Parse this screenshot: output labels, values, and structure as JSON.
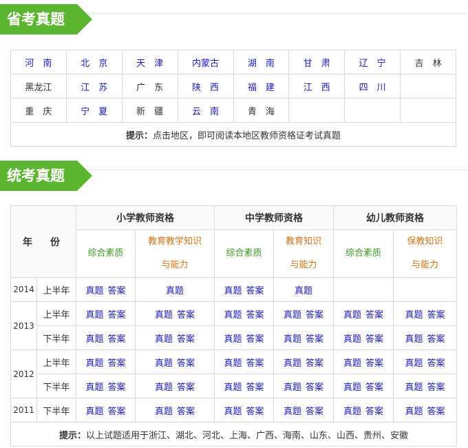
{
  "sections": {
    "provincial_title": "省考真题",
    "unified_title": "统考真题"
  },
  "provinces": [
    [
      "河　南",
      "北　京",
      "天　津",
      "内蒙古",
      "湖　南",
      "甘　肃",
      "辽　宁",
      "吉　林"
    ],
    [
      "黑龙江",
      "江　苏",
      "广　东",
      "陕　西",
      "福　建",
      "江　西",
      "四　川",
      ""
    ],
    [
      "重　庆",
      "宁　夏",
      "新　疆",
      "云　南",
      "青　海",
      "",
      "",
      ""
    ]
  ],
  "province_links": [
    [
      true,
      true,
      true,
      true,
      true,
      true,
      true,
      false
    ],
    [
      false,
      true,
      false,
      true,
      true,
      true,
      true,
      false
    ],
    [
      false,
      true,
      false,
      true,
      false,
      false,
      false,
      false
    ]
  ],
  "province_tip": {
    "label": "提示：",
    "text": "点击地区，即可阅读本地区教师资格证考试真题"
  },
  "exam": {
    "year_header": "年　份",
    "groups": [
      "小学教师资格",
      "中学教师资格",
      "幼儿教师资格"
    ],
    "subheads": [
      {
        "l1": "综合素质",
        "l2": ""
      },
      {
        "l1": "教育教学知识",
        "l2": "与能力"
      },
      {
        "l1": "综合素质",
        "l2": ""
      },
      {
        "l1": "教育知识",
        "l2": "与能力"
      },
      {
        "l1": "综合素质",
        "l2": ""
      },
      {
        "l1": "保教知识",
        "l2": "与能力"
      }
    ],
    "link_question": "真题",
    "link_answer": "答案",
    "rows": [
      {
        "year": "2014",
        "half": "上半年",
        "cells": [
          "qa",
          "q",
          "qa",
          "q",
          "",
          ""
        ]
      },
      {
        "year": "2013",
        "half": "上半年",
        "cells": [
          "qa",
          "qa",
          "qa",
          "qa",
          "qa",
          "qa"
        ]
      },
      {
        "year": "",
        "half": "下半年",
        "cells": [
          "qa",
          "qa",
          "qa",
          "qa",
          "qa",
          "qa"
        ]
      },
      {
        "year": "2012",
        "half": "上半年",
        "cells": [
          "qa",
          "qa",
          "qa",
          "qa",
          "qa",
          "qa"
        ]
      },
      {
        "year": "",
        "half": "下半年",
        "cells": [
          "qa",
          "qa",
          "qa",
          "qa",
          "qa",
          "qa"
        ]
      },
      {
        "year": "2011",
        "half": "下半年",
        "cells": [
          "qa",
          "qa",
          "qa",
          "qa",
          "qa",
          "qa"
        ]
      }
    ],
    "tip": {
      "label": "提示：",
      "text": "以上试题适用于浙江、湖北、河北、上海、广西、海南、山东、山西、贵州、安徽"
    }
  }
}
